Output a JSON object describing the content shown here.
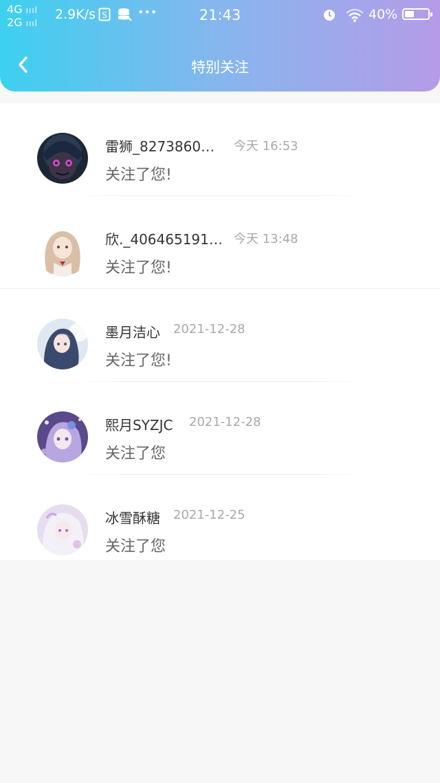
{
  "status_bar": {
    "network_top": "4G",
    "network_bottom": "2G",
    "signal_bars": "ıııl",
    "speed": "2.9K/s",
    "more": "•••",
    "time": "21:43",
    "battery": "40%",
    "battery_level": 0.4,
    "icons": [
      "sim-icon",
      "storage-icon",
      "alarm-icon",
      "wifi-icon",
      "battery-icon"
    ]
  },
  "nav": {
    "title": "特别关注",
    "back_icon": "chevron-left-icon"
  },
  "items": [
    {
      "name": "雷狮_8273860…",
      "time": "今天 16:53",
      "message": "关注了您!"
    },
    {
      "name": "欣._406465191…",
      "time": "今天 13:48",
      "message": "关注了您!"
    },
    {
      "name": "墨月洁心",
      "time": "2021-12-28",
      "message": "关注了您!"
    },
    {
      "name": "熙月SYZJC",
      "time": "2021-12-28",
      "message": "关注了您"
    },
    {
      "name": "冰雪酥糖",
      "time": "2021-12-25",
      "message": "关注了您"
    }
  ],
  "colors": {
    "header_start": "#3dd0ef",
    "header_end": "#b59be8",
    "name": "#333333",
    "time": "#a8a8a8",
    "message": "#666666"
  }
}
